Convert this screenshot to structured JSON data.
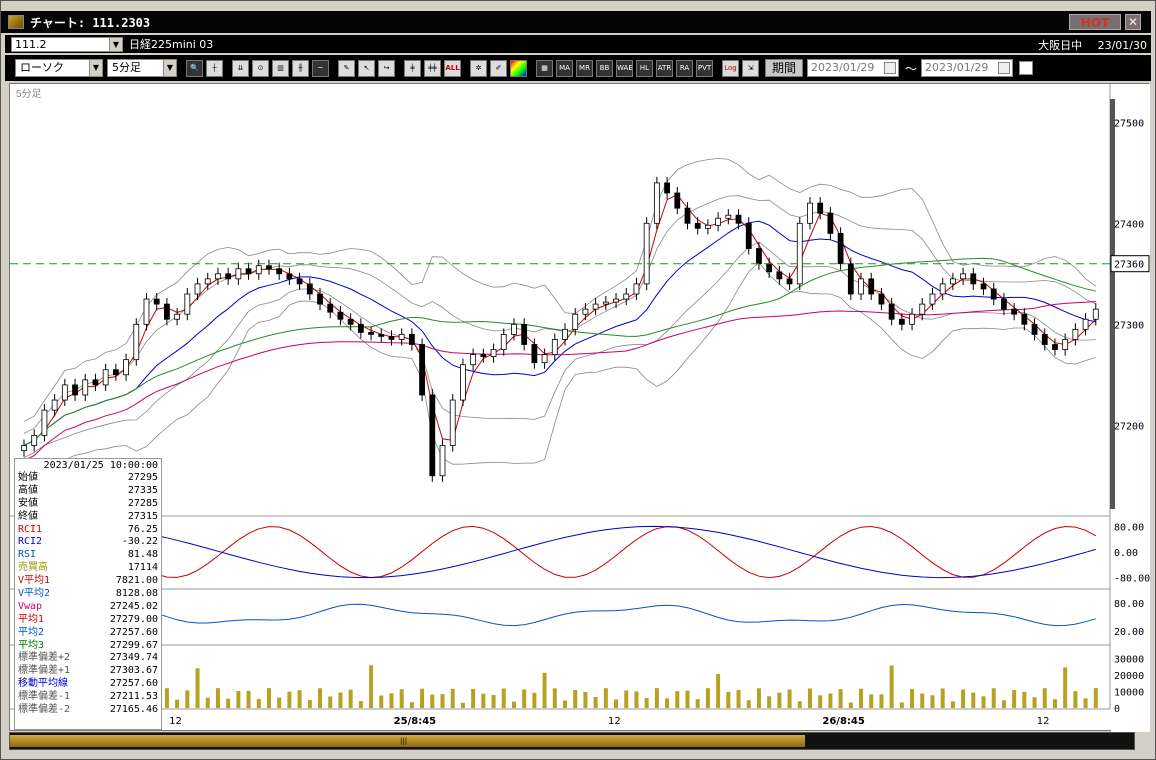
{
  "window": {
    "title": "チャート: 111.2303",
    "hot_label": "HOT",
    "close_glyph": "✕"
  },
  "symbol_bar": {
    "symbol_code": "111.2",
    "symbol_name": "日経225mini 03",
    "market": "大阪日中",
    "date": "23/01/30"
  },
  "toolbar": {
    "chart_type": "ローソク",
    "interval": "5分足",
    "icons": [
      "zoom-in-icon",
      "crosshair-icon",
      "down-arrow-icon",
      "zoom-reset-icon",
      "bar-chart-icon",
      "candle-icon",
      "line-flat-icon",
      "pen-draw-icon",
      "cursor-icon",
      "arrow-curve-icon",
      "candle-single-icon",
      "candle-pair-icon",
      "all-label",
      "settings-icon",
      "brush-icon",
      "color-icon",
      "grid-icon"
    ],
    "indicator_buttons": [
      "MA",
      "MR",
      "BB",
      "WAE",
      "HL",
      "ATR",
      "RA",
      "PVT"
    ],
    "log_label": "Log",
    "period_label": "期間",
    "date_from": "2023/01/29",
    "date_to": "2023/01/29",
    "range_sep": "～"
  },
  "chart": {
    "interval_label": "5分足",
    "price_ticks": [
      "27500",
      "27400",
      "27300",
      "27200"
    ],
    "current_price": "27360",
    "rci_ticks": [
      "80.00",
      "0.00",
      "-80.00"
    ],
    "rsi_ticks": [
      "80.00",
      "20.00"
    ],
    "volume_ticks": [
      "30000",
      "20000",
      "10000",
      "0"
    ],
    "x_labels": [
      "12",
      "25/8:45",
      "12",
      "26/8:45",
      "12"
    ]
  },
  "chart_data": {
    "type": "candlestick",
    "price_range": [
      27130,
      27530
    ],
    "current_price": 27360,
    "close_series": [
      27180,
      27190,
      27215,
      27225,
      27240,
      27230,
      27245,
      27240,
      27255,
      27250,
      27265,
      27300,
      27325,
      27320,
      27305,
      27310,
      27330,
      27340,
      27345,
      27350,
      27345,
      27355,
      27350,
      27358,
      27355,
      27350,
      27345,
      27340,
      27330,
      27320,
      27312,
      27305,
      27300,
      27292,
      27290,
      27288,
      27285,
      27290,
      27280,
      27230,
      27150,
      27180,
      27225,
      27260,
      27270,
      27268,
      27275,
      27290,
      27300,
      27280,
      27262,
      27270,
      27285,
      27295,
      27310,
      27315,
      27320,
      27322,
      27325,
      27330,
      27340,
      27400,
      27440,
      27430,
      27415,
      27400,
      27395,
      27398,
      27405,
      27408,
      27400,
      27375,
      27360,
      27352,
      27345,
      27340,
      27400,
      27420,
      27410,
      27390,
      27360,
      27330,
      27345,
      27330,
      27320,
      27305,
      27300,
      27310,
      27320,
      27330,
      27340,
      27345,
      27350,
      27340,
      27335,
      27325,
      27315,
      27310,
      27300,
      27290,
      27280,
      27275,
      27285,
      27295,
      27305,
      27315
    ],
    "indicators": {
      "RCI1": 76.25,
      "RCI2": -30.22,
      "RSI": 81.48,
      "volume": 17114,
      "V_MA1": 7821.0,
      "V_MA2": 8128.08,
      "VWAP": 27245.02,
      "MA1": 27279.0,
      "MA2": 27257.6,
      "MA3": 27299.67,
      "BB_plus2": 27349.74,
      "BB_plus1": 27303.67,
      "BB_mid": 27257.6,
      "BB_minus1": 27211.53,
      "BB_minus2": 27165.46
    }
  },
  "info": {
    "datetime": "2023/01/25 10:00:00",
    "rows": [
      {
        "label": "始値",
        "value": "27295",
        "color": "#000000"
      },
      {
        "label": "高値",
        "value": "27335",
        "color": "#000000"
      },
      {
        "label": "安値",
        "value": "27285",
        "color": "#000000"
      },
      {
        "label": "終値",
        "value": "27315",
        "color": "#000000"
      },
      {
        "label": "RCI1",
        "value": "76.25",
        "color": "#cc0000"
      },
      {
        "label": "RCI2",
        "value": "-30.22",
        "color": "#0000cc"
      },
      {
        "label": "RSI",
        "value": "81.48",
        "color": "#0055cc"
      },
      {
        "label": "売買高",
        "value": "17114",
        "color": "#999900"
      },
      {
        "label": "V平均1",
        "value": "7821.00",
        "color": "#cc0000"
      },
      {
        "label": "V平均2",
        "value": "8128.08",
        "color": "#0055cc"
      },
      {
        "label": "Vwap",
        "value": "27245.02",
        "color": "#cc0066"
      },
      {
        "label": "平均1",
        "value": "27279.00",
        "color": "#cc0000"
      },
      {
        "label": "平均2",
        "value": "27257.60",
        "color": "#0055cc"
      },
      {
        "label": "平均3",
        "value": "27299.67",
        "color": "#007700"
      },
      {
        "label": "標準偏差+2",
        "value": "27349.74",
        "color": "#555555"
      },
      {
        "label": "標準偏差+1",
        "value": "27303.67",
        "color": "#555555"
      },
      {
        "label": "移動平均線",
        "value": "27257.60",
        "color": "#0000cc"
      },
      {
        "label": "標準偏差-1",
        "value": "27211.53",
        "color": "#555555"
      },
      {
        "label": "標準偏差-2",
        "value": "27165.46",
        "color": "#555555"
      }
    ]
  },
  "colors": {
    "up_candle": "#ffffff",
    "down_candle": "#000000",
    "ma1": "#cc0000",
    "ma2": "#0000cc",
    "ma3": "#2a8a2a",
    "vwap": "#cc0066",
    "band": "#888888",
    "volume": "#b8a020",
    "current_line": "#2a8a2a"
  }
}
